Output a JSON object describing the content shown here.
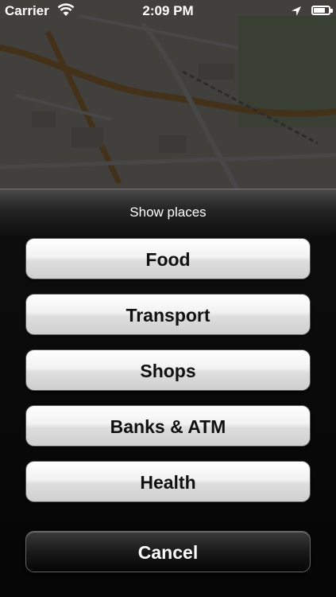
{
  "status_bar": {
    "carrier": "Carrier",
    "time": "2:09 PM",
    "wifi_icon": "wifi-icon",
    "location_icon": "location-arrow-icon",
    "battery_icon": "battery-icon",
    "battery_level": 0.8
  },
  "sheet": {
    "title": "Show places",
    "buttons": [
      {
        "label": "Food"
      },
      {
        "label": "Transport"
      },
      {
        "label": "Shops"
      },
      {
        "label": "Banks & ATM"
      },
      {
        "label": "Health"
      }
    ],
    "cancel_label": "Cancel"
  },
  "colors": {
    "sheet_background": "#000000",
    "button_light": "#eeeeee",
    "button_dark": "#1a1a1a",
    "text_dark": "#111111",
    "text_light": "#ffffff"
  }
}
